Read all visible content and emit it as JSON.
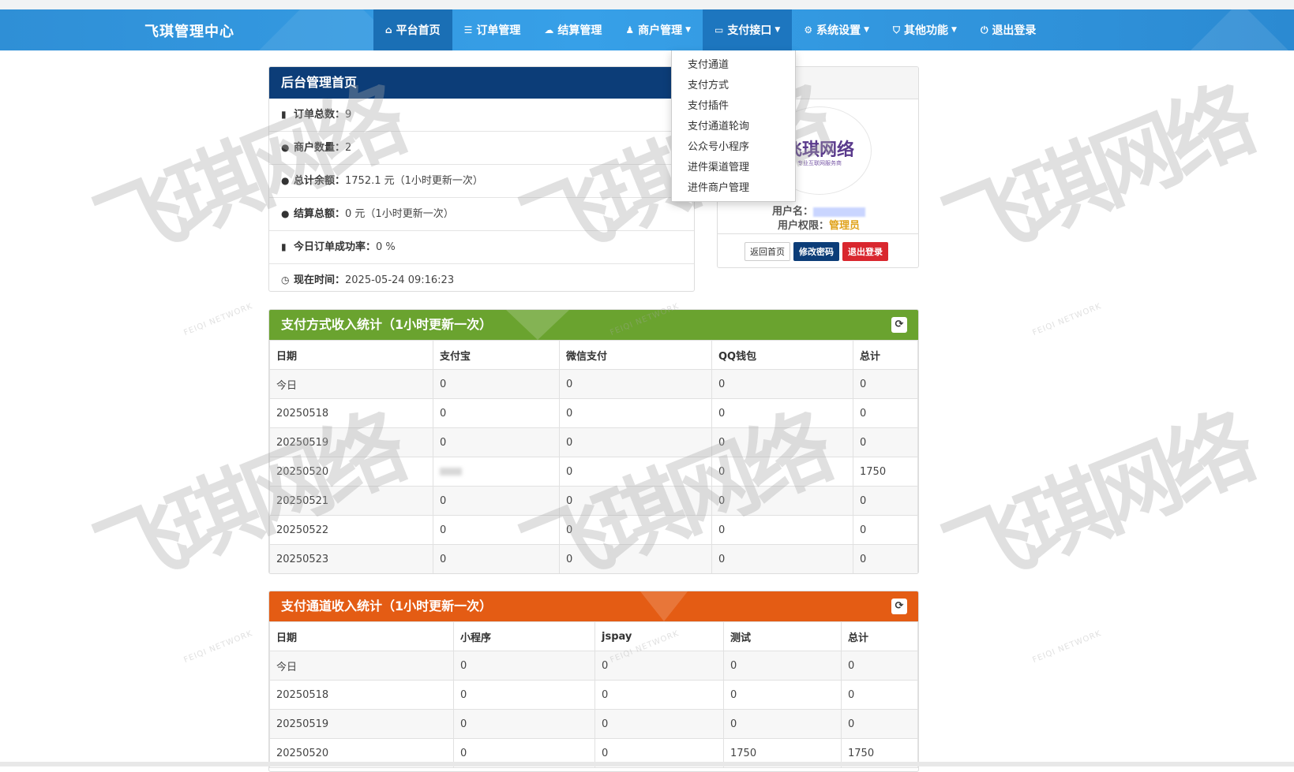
{
  "brand": "飞琪管理中心",
  "nav": [
    {
      "id": "home",
      "label": "平台首页",
      "icon": "home-icon",
      "glyph": "⌂",
      "caret": false
    },
    {
      "id": "orders",
      "label": "订单管理",
      "icon": "list-icon",
      "glyph": "☰",
      "caret": false
    },
    {
      "id": "settlement",
      "label": "结算管理",
      "icon": "cloud-icon",
      "glyph": "☁",
      "caret": false
    },
    {
      "id": "merchants",
      "label": "商户管理",
      "icon": "user-icon",
      "glyph": "♟",
      "caret": true
    },
    {
      "id": "payment",
      "label": "支付接口",
      "icon": "card-icon",
      "glyph": "▭",
      "caret": true
    },
    {
      "id": "system",
      "label": "系统设置",
      "icon": "gear-icon",
      "glyph": "⚙",
      "caret": true
    },
    {
      "id": "other",
      "label": "其他功能",
      "icon": "shield-icon",
      "glyph": "⛉",
      "caret": true
    },
    {
      "id": "logout",
      "label": "退出登录",
      "icon": "power-icon",
      "glyph": "⏻",
      "caret": false
    }
  ],
  "dropdown": [
    "支付通道",
    "支付方式",
    "支付插件",
    "支付通道轮询",
    "公众号小程序",
    "进件渠道管理",
    "进件商户管理"
  ],
  "home_panel": {
    "title": "后台管理首页",
    "rows": [
      {
        "icon": "bar-chart-icon",
        "glyph": "▮",
        "label": "订单总数：",
        "value": "9"
      },
      {
        "icon": "drop-icon",
        "glyph": "●",
        "label": "商户数量：",
        "value": "2"
      },
      {
        "icon": "drop-icon",
        "glyph": "●",
        "label": "总计余额：",
        "value": "1752.1 元（1小时更新一次）"
      },
      {
        "icon": "drop-icon",
        "glyph": "●",
        "label": "结算总额：",
        "value": "0 元（1小时更新一次）"
      },
      {
        "icon": "bar-chart-icon",
        "glyph": "▮",
        "label": "今日订单成功率：",
        "value": "0 %"
      },
      {
        "icon": "clock-icon",
        "glyph": "◷",
        "label": "现在时间：",
        "value": "2025-05-24 09:16:23"
      }
    ]
  },
  "user_panel": {
    "logo_text": "飞琪网络",
    "logo_sub": "专业互联网服务商",
    "username_label": "用户名：",
    "role_label": "用户权限：",
    "role_value": "管理员",
    "buttons": {
      "home": "返回首页",
      "password": "修改密码",
      "logout": "退出登录"
    }
  },
  "method_table": {
    "title": "支付方式收入统计（1小时更新一次）",
    "refresh_glyph": "⟳",
    "columns": [
      "日期",
      "支付宝",
      "微信支付",
      "QQ钱包",
      "总计"
    ],
    "rows": [
      [
        "今日",
        "0",
        "0",
        "0",
        "0"
      ],
      [
        "20250518",
        "0",
        "0",
        "0",
        "0"
      ],
      [
        "20250519",
        "0",
        "0",
        "0",
        "0"
      ],
      [
        "20250520",
        "",
        "0",
        "0",
        "1750"
      ],
      [
        "20250521",
        "0",
        "0",
        "0",
        "0"
      ],
      [
        "20250522",
        "0",
        "0",
        "0",
        "0"
      ],
      [
        "20250523",
        "0",
        "0",
        "0",
        "0"
      ]
    ]
  },
  "channel_table": {
    "title": "支付通道收入统计（1小时更新一次）",
    "refresh_glyph": "⟳",
    "columns": [
      "日期",
      "小程序",
      "jspay",
      "测试",
      "总计"
    ],
    "rows": [
      [
        "今日",
        "0",
        "0",
        "0",
        "0"
      ],
      [
        "20250518",
        "0",
        "0",
        "0",
        "0"
      ],
      [
        "20250519",
        "0",
        "0",
        "0",
        "0"
      ],
      [
        "20250520",
        "0",
        "0",
        "1750",
        "1750"
      ]
    ]
  },
  "watermark": {
    "big": "飞琪网络",
    "small": "FEIQI NETWORK"
  }
}
